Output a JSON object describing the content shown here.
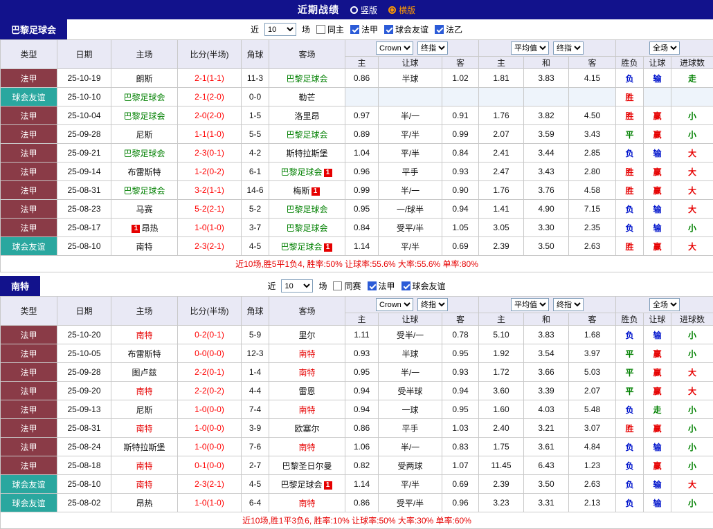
{
  "topbar": {
    "title": "近期战绩",
    "layout_options": [
      {
        "label": "竖版",
        "selected": false
      },
      {
        "label": "横版",
        "selected": true
      }
    ]
  },
  "table": {
    "main_headers": [
      "类型",
      "日期",
      "主场",
      "比分(半场)",
      "角球",
      "客场"
    ],
    "sub_headers": [
      "主",
      "让球",
      "客",
      "主",
      "和",
      "客",
      "胜负",
      "让球",
      "进球数"
    ]
  },
  "colors": {
    "topbar_navy": "#12128c",
    "selected_option_orange": "#ff9900",
    "league_ligue1_bg": "#8a3b47",
    "league_friendly_bg": "#2aa79f",
    "score_red": "#ff0000",
    "team_green": "#008000",
    "team_red": "#e60000",
    "result_win_red": "#e60000",
    "result_draw_green": "#008000",
    "result_lose_blue": "#0014cc",
    "summary_red": "#e60000",
    "checkbox_blue": "#2b5bd7"
  },
  "sections": [
    {
      "team": "巴黎足球会",
      "filter": {
        "prefix": "近",
        "count": "10",
        "suffix": "场",
        "checkboxes": [
          {
            "key": "same-venue",
            "label": "同主",
            "checked": false
          },
          {
            "key": "ligue1",
            "label": "法甲",
            "checked": true
          },
          {
            "key": "club-friendly",
            "label": "球会友谊",
            "checked": true
          },
          {
            "key": "ligue2",
            "label": "法乙",
            "checked": true
          }
        ]
      },
      "dropdowns": {
        "bookmaker": "Crown",
        "asian_time": "终指",
        "euro_source": "平均值",
        "euro_time": "终指",
        "scope": "全场"
      },
      "rows": [
        {
          "league": "法甲",
          "league_style": "ligue1",
          "date": "25-10-19",
          "home": {
            "name": "朗斯"
          },
          "score": "2-1(1-1)",
          "corner": "11-3",
          "away": {
            "name": "巴黎足球会",
            "color": "green"
          },
          "asian": [
            "0.86",
            "半球",
            "1.02"
          ],
          "euro": [
            "1.81",
            "3.83",
            "4.15"
          ],
          "outcome": [
            {
              "text": "负",
              "color": "blue"
            },
            {
              "text": "输",
              "color": "blue"
            },
            {
              "text": "走",
              "color": "green"
            }
          ]
        },
        {
          "league": "球会友谊",
          "league_style": "friendly",
          "date": "25-10-10",
          "home": {
            "name": "巴黎足球会",
            "color": "green"
          },
          "score": "2-1(2-0)",
          "corner": "0-0",
          "away": {
            "name": "勒芒"
          },
          "asian": [
            "",
            "",
            ""
          ],
          "euro": [
            "",
            "",
            ""
          ],
          "outcome": [
            {
              "text": "胜",
              "color": "red"
            },
            {
              "text": "",
              "color": ""
            },
            {
              "text": "",
              "color": ""
            }
          ]
        },
        {
          "league": "法甲",
          "league_style": "ligue1",
          "date": "25-10-04",
          "home": {
            "name": "巴黎足球会",
            "color": "green"
          },
          "score": "2-0(2-0)",
          "corner": "1-5",
          "away": {
            "name": "洛里昂"
          },
          "asian": [
            "0.97",
            "半/一",
            "0.91"
          ],
          "euro": [
            "1.76",
            "3.82",
            "4.50"
          ],
          "outcome": [
            {
              "text": "胜",
              "color": "red"
            },
            {
              "text": "赢",
              "color": "red"
            },
            {
              "text": "小",
              "color": "green"
            }
          ]
        },
        {
          "league": "法甲",
          "league_style": "ligue1",
          "date": "25-09-28",
          "home": {
            "name": "尼斯"
          },
          "score": "1-1(1-0)",
          "corner": "5-5",
          "away": {
            "name": "巴黎足球会",
            "color": "green"
          },
          "asian": [
            "0.89",
            "平/半",
            "0.99"
          ],
          "euro": [
            "2.07",
            "3.59",
            "3.43"
          ],
          "outcome": [
            {
              "text": "平",
              "color": "green"
            },
            {
              "text": "赢",
              "color": "red"
            },
            {
              "text": "小",
              "color": "green"
            }
          ]
        },
        {
          "league": "法甲",
          "league_style": "ligue1",
          "date": "25-09-21",
          "home": {
            "name": "巴黎足球会",
            "color": "green"
          },
          "score": "2-3(0-1)",
          "corner": "4-2",
          "away": {
            "name": "斯特拉斯堡"
          },
          "asian": [
            "1.04",
            "平/半",
            "0.84"
          ],
          "euro": [
            "2.41",
            "3.44",
            "2.85"
          ],
          "outcome": [
            {
              "text": "负",
              "color": "blue"
            },
            {
              "text": "输",
              "color": "blue"
            },
            {
              "text": "大",
              "color": "red"
            }
          ]
        },
        {
          "league": "法甲",
          "league_style": "ligue1",
          "date": "25-09-14",
          "home": {
            "name": "布雷斯特"
          },
          "score": "1-2(0-2)",
          "corner": "6-1",
          "away": {
            "name": "巴黎足球会",
            "color": "green",
            "badge": "1"
          },
          "asian": [
            "0.96",
            "平手",
            "0.93"
          ],
          "euro": [
            "2.47",
            "3.43",
            "2.80"
          ],
          "outcome": [
            {
              "text": "胜",
              "color": "red"
            },
            {
              "text": "赢",
              "color": "red"
            },
            {
              "text": "大",
              "color": "red"
            }
          ]
        },
        {
          "league": "法甲",
          "league_style": "ligue1",
          "date": "25-08-31",
          "home": {
            "name": "巴黎足球会",
            "color": "green"
          },
          "score": "3-2(1-1)",
          "corner": "14-6",
          "away": {
            "name": "梅斯",
            "badge": "1"
          },
          "asian": [
            "0.99",
            "半/一",
            "0.90"
          ],
          "euro": [
            "1.76",
            "3.76",
            "4.58"
          ],
          "outcome": [
            {
              "text": "胜",
              "color": "red"
            },
            {
              "text": "赢",
              "color": "red"
            },
            {
              "text": "大",
              "color": "red"
            }
          ]
        },
        {
          "league": "法甲",
          "league_style": "ligue1",
          "date": "25-08-23",
          "home": {
            "name": "马赛"
          },
          "score": "5-2(2-1)",
          "corner": "5-2",
          "away": {
            "name": "巴黎足球会",
            "color": "green"
          },
          "asian": [
            "0.95",
            "一/球半",
            "0.94"
          ],
          "euro": [
            "1.41",
            "4.90",
            "7.15"
          ],
          "outcome": [
            {
              "text": "负",
              "color": "blue"
            },
            {
              "text": "输",
              "color": "blue"
            },
            {
              "text": "大",
              "color": "red"
            }
          ]
        },
        {
          "league": "法甲",
          "league_style": "ligue1",
          "date": "25-08-17",
          "home": {
            "name": "昂热",
            "badge": "1",
            "badge_pos": "left"
          },
          "score": "1-0(1-0)",
          "corner": "3-7",
          "away": {
            "name": "巴黎足球会",
            "color": "green"
          },
          "asian": [
            "0.84",
            "受平/半",
            "1.05"
          ],
          "euro": [
            "3.05",
            "3.30",
            "2.35"
          ],
          "outcome": [
            {
              "text": "负",
              "color": "blue"
            },
            {
              "text": "输",
              "color": "blue"
            },
            {
              "text": "小",
              "color": "green"
            }
          ]
        },
        {
          "league": "球会友谊",
          "league_style": "friendly",
          "date": "25-08-10",
          "home": {
            "name": "南特"
          },
          "score": "2-3(2-1)",
          "corner": "4-5",
          "away": {
            "name": "巴黎足球会",
            "color": "green",
            "badge": "1"
          },
          "asian": [
            "1.14",
            "平/半",
            "0.69"
          ],
          "euro": [
            "2.39",
            "3.50",
            "2.63"
          ],
          "outcome": [
            {
              "text": "胜",
              "color": "red"
            },
            {
              "text": "赢",
              "color": "red"
            },
            {
              "text": "大",
              "color": "red"
            }
          ]
        }
      ],
      "summary": "近10场,胜5平1负4, 胜率:50% 让球率:55.6% 大率:55.6% 单率:80%"
    },
    {
      "team": "南特",
      "filter": {
        "prefix": "近",
        "count": "10",
        "suffix": "场",
        "checkboxes": [
          {
            "key": "same-competition",
            "label": "同赛",
            "checked": false
          },
          {
            "key": "ligue1",
            "label": "法甲",
            "checked": true
          },
          {
            "key": "club-friendly",
            "label": "球会友谊",
            "checked": true
          }
        ]
      },
      "dropdowns": {
        "bookmaker": "Crown",
        "asian_time": "终指",
        "euro_source": "平均值",
        "euro_time": "终指",
        "scope": "全场"
      },
      "rows": [
        {
          "league": "法甲",
          "league_style": "ligue1",
          "date": "25-10-20",
          "home": {
            "name": "南特",
            "color": "red"
          },
          "score": "0-2(0-1)",
          "corner": "5-9",
          "away": {
            "name": "里尔"
          },
          "asian": [
            "1.11",
            "受半/一",
            "0.78"
          ],
          "euro": [
            "5.10",
            "3.83",
            "1.68"
          ],
          "outcome": [
            {
              "text": "负",
              "color": "blue"
            },
            {
              "text": "输",
              "color": "blue"
            },
            {
              "text": "小",
              "color": "green"
            }
          ]
        },
        {
          "league": "法甲",
          "league_style": "ligue1",
          "date": "25-10-05",
          "home": {
            "name": "布雷斯特"
          },
          "score": "0-0(0-0)",
          "corner": "12-3",
          "away": {
            "name": "南特",
            "color": "red"
          },
          "asian": [
            "0.93",
            "半球",
            "0.95"
          ],
          "euro": [
            "1.92",
            "3.54",
            "3.97"
          ],
          "outcome": [
            {
              "text": "平",
              "color": "green"
            },
            {
              "text": "赢",
              "color": "red"
            },
            {
              "text": "小",
              "color": "green"
            }
          ]
        },
        {
          "league": "法甲",
          "league_style": "ligue1",
          "date": "25-09-28",
          "home": {
            "name": "图卢兹"
          },
          "score": "2-2(0-1)",
          "corner": "1-4",
          "away": {
            "name": "南特",
            "color": "red"
          },
          "asian": [
            "0.95",
            "半/一",
            "0.93"
          ],
          "euro": [
            "1.72",
            "3.66",
            "5.03"
          ],
          "outcome": [
            {
              "text": "平",
              "color": "green"
            },
            {
              "text": "赢",
              "color": "red"
            },
            {
              "text": "大",
              "color": "red"
            }
          ]
        },
        {
          "league": "法甲",
          "league_style": "ligue1",
          "date": "25-09-20",
          "home": {
            "name": "南特",
            "color": "red"
          },
          "score": "2-2(0-2)",
          "corner": "4-4",
          "away": {
            "name": "雷恩"
          },
          "asian": [
            "0.94",
            "受半球",
            "0.94"
          ],
          "euro": [
            "3.60",
            "3.39",
            "2.07"
          ],
          "outcome": [
            {
              "text": "平",
              "color": "green"
            },
            {
              "text": "赢",
              "color": "red"
            },
            {
              "text": "大",
              "color": "red"
            }
          ]
        },
        {
          "league": "法甲",
          "league_style": "ligue1",
          "date": "25-09-13",
          "home": {
            "name": "尼斯"
          },
          "score": "1-0(0-0)",
          "corner": "7-4",
          "away": {
            "name": "南特",
            "color": "red"
          },
          "asian": [
            "0.94",
            "一球",
            "0.95"
          ],
          "euro": [
            "1.60",
            "4.03",
            "5.48"
          ],
          "outcome": [
            {
              "text": "负",
              "color": "blue"
            },
            {
              "text": "走",
              "color": "green"
            },
            {
              "text": "小",
              "color": "green"
            }
          ]
        },
        {
          "league": "法甲",
          "league_style": "ligue1",
          "date": "25-08-31",
          "home": {
            "name": "南特",
            "color": "red"
          },
          "score": "1-0(0-0)",
          "corner": "3-9",
          "away": {
            "name": "欧塞尔"
          },
          "asian": [
            "0.86",
            "平手",
            "1.03"
          ],
          "euro": [
            "2.40",
            "3.21",
            "3.07"
          ],
          "outcome": [
            {
              "text": "胜",
              "color": "red"
            },
            {
              "text": "赢",
              "color": "red"
            },
            {
              "text": "小",
              "color": "green"
            }
          ]
        },
        {
          "league": "法甲",
          "league_style": "ligue1",
          "date": "25-08-24",
          "home": {
            "name": "斯特拉斯堡"
          },
          "score": "1-0(0-0)",
          "corner": "7-6",
          "away": {
            "name": "南特",
            "color": "red"
          },
          "asian": [
            "1.06",
            "半/一",
            "0.83"
          ],
          "euro": [
            "1.75",
            "3.61",
            "4.84"
          ],
          "outcome": [
            {
              "text": "负",
              "color": "blue"
            },
            {
              "text": "输",
              "color": "blue"
            },
            {
              "text": "小",
              "color": "green"
            }
          ]
        },
        {
          "league": "法甲",
          "league_style": "ligue1",
          "date": "25-08-18",
          "home": {
            "name": "南特",
            "color": "red"
          },
          "score": "0-1(0-0)",
          "corner": "2-7",
          "away": {
            "name": "巴黎圣日尔曼"
          },
          "asian": [
            "0.82",
            "受两球",
            "1.07"
          ],
          "euro": [
            "11.45",
            "6.43",
            "1.23"
          ],
          "outcome": [
            {
              "text": "负",
              "color": "blue"
            },
            {
              "text": "赢",
              "color": "red"
            },
            {
              "text": "小",
              "color": "green"
            }
          ]
        },
        {
          "league": "球会友谊",
          "league_style": "friendly",
          "date": "25-08-10",
          "home": {
            "name": "南特",
            "color": "red"
          },
          "score": "2-3(2-1)",
          "corner": "4-5",
          "away": {
            "name": "巴黎足球会",
            "badge": "1"
          },
          "asian": [
            "1.14",
            "平/半",
            "0.69"
          ],
          "euro": [
            "2.39",
            "3.50",
            "2.63"
          ],
          "outcome": [
            {
              "text": "负",
              "color": "blue"
            },
            {
              "text": "输",
              "color": "blue"
            },
            {
              "text": "大",
              "color": "red"
            }
          ]
        },
        {
          "league": "球会友谊",
          "league_style": "friendly",
          "date": "25-08-02",
          "home": {
            "name": "昂热"
          },
          "score": "1-0(1-0)",
          "corner": "6-4",
          "away": {
            "name": "南特",
            "color": "red"
          },
          "asian": [
            "0.86",
            "受平/半",
            "0.96"
          ],
          "euro": [
            "3.23",
            "3.31",
            "2.13"
          ],
          "outcome": [
            {
              "text": "负",
              "color": "blue"
            },
            {
              "text": "输",
              "color": "blue"
            },
            {
              "text": "小",
              "color": "green"
            }
          ]
        }
      ],
      "summary": "近10场,胜1平3负6, 胜率:10% 让球率:50% 大率:30% 单率:60%"
    }
  ]
}
